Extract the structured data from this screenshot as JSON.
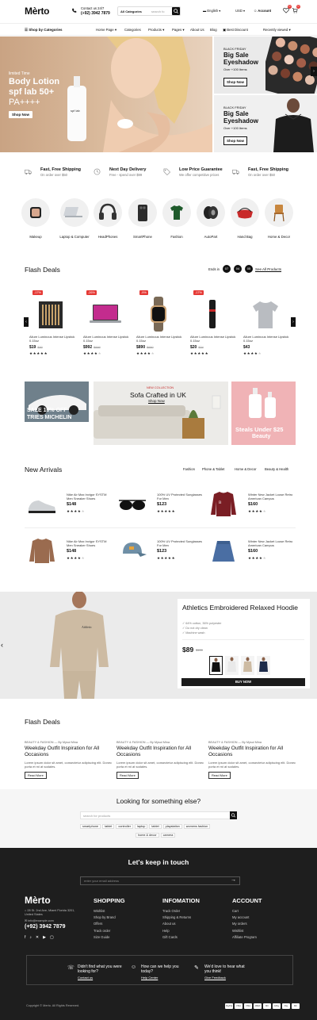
{
  "header": {
    "logo": "Mèrto",
    "contact_label": "Contact us 24/7",
    "contact_phone": "(+92) 3942 7879",
    "search_category": "All Categories",
    "search_placeholder": "search fo",
    "language": "English",
    "currency": "USD",
    "account": "Account",
    "wishlist_count": "0",
    "cart_count": "0"
  },
  "nav": {
    "categories_button": "Shop by Categories",
    "items": [
      "Home Page",
      "Categories",
      "Products",
      "Pages",
      "About Us",
      "Blog",
      "Best Discount",
      "Recently viewed"
    ]
  },
  "hero": {
    "kicker": "limited Time",
    "title_line1": "Body Lotion",
    "title_line2": "spf lab 50+",
    "title_line3": "PA++++",
    "button": "Shop Now",
    "bottle_text": "spf lab"
  },
  "promos": [
    {
      "kicker": "BLACK FRIDAY",
      "title1": "Big Sale",
      "title2": "Eyeshadow",
      "sub": "Over +100 Items",
      "button": "Shop Now"
    },
    {
      "kicker": "BLACK FRIDAY",
      "title1": "Big Sale",
      "title2": "Eyeshadow",
      "sub": "Over +100 Items",
      "button": "Shop Now"
    }
  ],
  "features": [
    {
      "title": "Fast, Free Shipping",
      "sub": "On order over $50",
      "icon": "truck-icon"
    },
    {
      "title": "Next Day Delivery",
      "sub": "Free - spend over $99",
      "icon": "clock-icon"
    },
    {
      "title": "Low Price Guarantee",
      "sub": "We offer competitive prices",
      "icon": "tag-icon"
    },
    {
      "title": "Fast, Free Shipping",
      "sub": "On order over $50",
      "icon": "truck-icon"
    }
  ],
  "categories": [
    "Makeup",
    "Laptop & Computer",
    "HeadPhones",
    "SmartPhone",
    "Fashion",
    "AutoPart",
    "Hand Bag",
    "Home & Decor"
  ],
  "flash_deals": {
    "title": "Flash Deals",
    "ends_in": "Ends in",
    "timer": [
      "07",
      "04",
      "05"
    ],
    "see_all": "See All Products",
    "products": [
      {
        "discount": "-17%",
        "name": "Allure Luminous Intense Lipstick 0.15oz",
        "price": "$19",
        "old": "$30",
        "rating": 5
      },
      {
        "discount": "-26%",
        "name": "Allure Luminous Intense Lipstick 0.15oz",
        "price": "$992",
        "old": "$999",
        "rating": 4
      },
      {
        "discount": "-9%",
        "name": "Allure Luminous Intense Lipstick 0.15oz",
        "price": "$890",
        "old": "$950",
        "rating": 4
      },
      {
        "discount": "-17%",
        "name": "Allure Luminous Intense Lipstick 0.15oz",
        "price": "$20",
        "old": "$34",
        "rating": 5
      },
      {
        "discount": "",
        "name": "Allure Luminous Intense Lipstick 0.15oz",
        "price": "$43",
        "old": "",
        "rating": 4
      }
    ]
  },
  "banners": {
    "left_line1": "SALE 10% OFF",
    "left_line2": "TRIES MICHELIN",
    "center_kicker": "NEW COLLECTION",
    "center_title": "Sofa Crafted in UK",
    "center_link": "Shop Now",
    "right_line1": "Steals Under $25",
    "right_line2": "Beauty"
  },
  "new_arrivals": {
    "title": "New Arrivals",
    "tabs": [
      "Fashion",
      "Phone & Tablet",
      "Home & Decor",
      "Beauty & Health"
    ],
    "items": [
      {
        "name": "Nike Air Max Invigor SYSTM Men Sneaker Shoes",
        "price": "$148",
        "rating": 4
      },
      {
        "name": "100% UV Protected Sunglasses For Men",
        "price": "$123",
        "rating": 5
      },
      {
        "name": "Winter New Jacket Loose Retro American Campus",
        "price": "$160",
        "rating": 4
      },
      {
        "name": "Nike Air Max Invigor SYSTM Men Sneaker Shoes",
        "price": "$148",
        "rating": 4
      },
      {
        "name": "100% UV Protected Sunglasses For Men",
        "price": "$123",
        "rating": 5
      },
      {
        "name": "Winter New Jacket Loose Retro American Campus",
        "price": "$160",
        "rating": 4
      }
    ]
  },
  "featured": {
    "title": "Athletics Embroidered Relaxed Hoodie",
    "bullets": [
      "64% cotton, 36% polyester",
      "Do not dry clean",
      "Machine wash"
    ],
    "price": "$89",
    "old": "$100",
    "button": "BUY NOW",
    "hoodie_print": "Athletic"
  },
  "blog": {
    "title": "Flash Deals",
    "posts": [
      {
        "meta": "BEAUTY & FASHION — By Mysul Mina",
        "title": "Weekday Outfit Inspiration for All Occasions",
        "excerpt": "Lorem ipsum dolor sit amet, consectetur adipiscing elit. Donec porta et mi at sodales.",
        "button": "Read More"
      },
      {
        "meta": "BEAUTY & FASHION — By Mysul Mina",
        "title": "Weekday Outfit Inspiration for All Occasions",
        "excerpt": "Lorem ipsum dolor sit amet, consectetur adipiscing elit. Donec porta et mi at sodales.",
        "button": "Read More"
      },
      {
        "meta": "BEAUTY & FASHION — By Mysul Mina",
        "title": "Weekday Outfit Inspiration for All Occasions",
        "excerpt": "Lorem ipsum dolor sit amet, consectetur adipiscing elit. Donec porta et mi at sodales.",
        "button": "Read More"
      }
    ]
  },
  "search_more": {
    "title": "Looking for something else?",
    "placeholder": "search for products",
    "tags": [
      "smartphone",
      "tablet",
      "controller",
      "laptop",
      "tablet",
      "playstation",
      "womens fashion",
      "home & decor",
      "camera"
    ]
  },
  "footer": {
    "newsletter_title": "Let's keep in touch",
    "newsletter_placeholder": "enter your email address",
    "logo": "Mèrto",
    "address": "28 St. 2nd Ave, Miami Florida 3201, United States",
    "email": "info@example.com",
    "phone": "(+92) 3942 7879",
    "columns": [
      {
        "title": "SHOPPING",
        "items": [
          "Wishlist",
          "Shop by Brand",
          "Offers",
          "Track order",
          "Size Guide"
        ]
      },
      {
        "title": "INFOMATION",
        "items": [
          "Track Order",
          "Shipping & Returns",
          "About us",
          "Help",
          "Gift Cards"
        ]
      },
      {
        "title": "ACCOUNT",
        "items": [
          "Cart",
          "My account",
          "My orders",
          "Wishlist",
          "Affiliate Program"
        ]
      }
    ],
    "help": [
      {
        "title": "Didn't find what you were looking for?",
        "link": "Contact us"
      },
      {
        "title": "How can we help you today?",
        "link": "Help Center"
      },
      {
        "title": "We'd love to hear what you think!",
        "link": "Give Feedback"
      }
    ],
    "copyright": "Copyright © Merto. All Rights Reserved.",
    "payments": [
      "PayPal",
      "VISA",
      "VISA",
      "AMEX",
      "MC",
      "GPay",
      "Pay",
      "MC"
    ]
  }
}
